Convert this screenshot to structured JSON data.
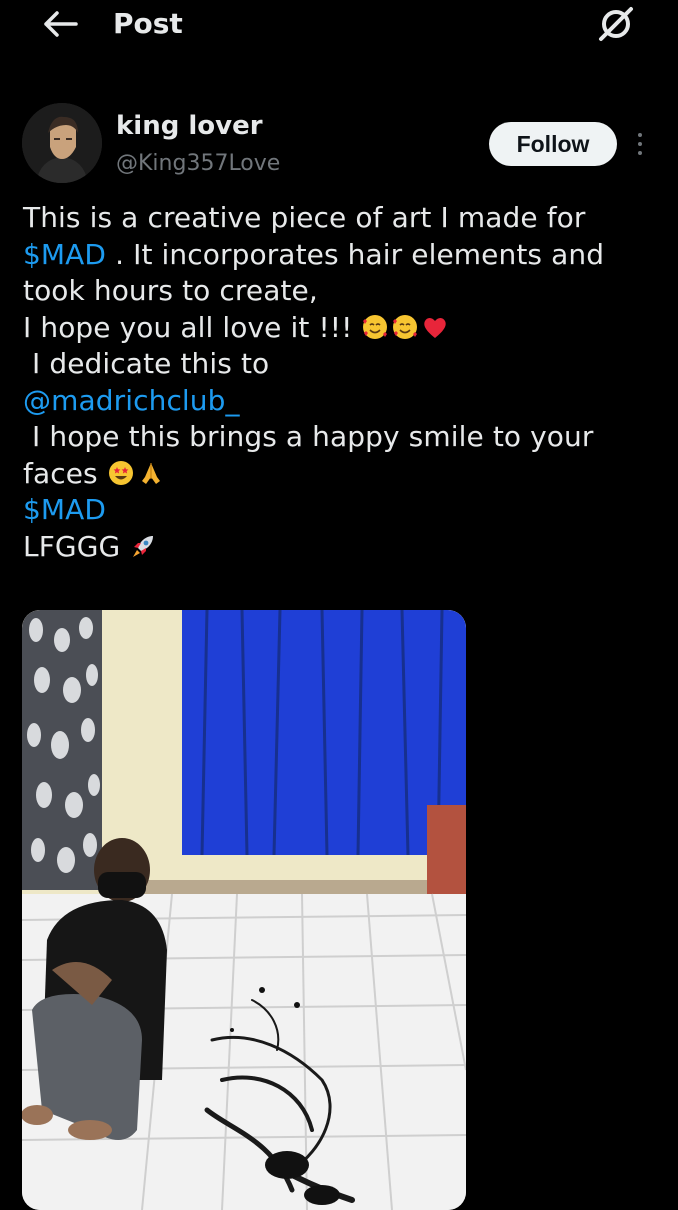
{
  "header": {
    "title": "Post",
    "back_icon": "arrow-left-icon",
    "grok_icon": "grok-icon"
  },
  "author": {
    "name": "king lover",
    "handle": "@King357Love",
    "follow_label": "Follow",
    "more_icon": "more-vertical-icon"
  },
  "post": {
    "line1": "This is a creative piece of art I made for",
    "cashtag1": "$MAD",
    "line2_rest": " . It incorporates hair elements and",
    "line3": "took hours to create,",
    "line4": "I hope you all love it !!! ",
    "line5": " I dedicate this to",
    "mention": "@madrichclub_",
    "line7": " I hope this brings a happy smile to your",
    "line8": "faces ",
    "cashtag2": "$MAD",
    "line10": "LFGGG ",
    "emojis": {
      "love": [
        "smiling-face-with-hearts-icon",
        "smiling-face-with-hearts-icon",
        "red-heart-icon"
      ],
      "faces": [
        "star-struck-icon",
        "folded-hands-icon"
      ],
      "lfggg": [
        "rocket-icon"
      ]
    }
  },
  "media": {
    "description_icon": "photo-hair-art-icon"
  },
  "colors": {
    "background": "#000000",
    "text": "#e7e9ea",
    "secondary": "#71767b",
    "link": "#1d9bf0",
    "follow_bg": "#eff3f4"
  }
}
